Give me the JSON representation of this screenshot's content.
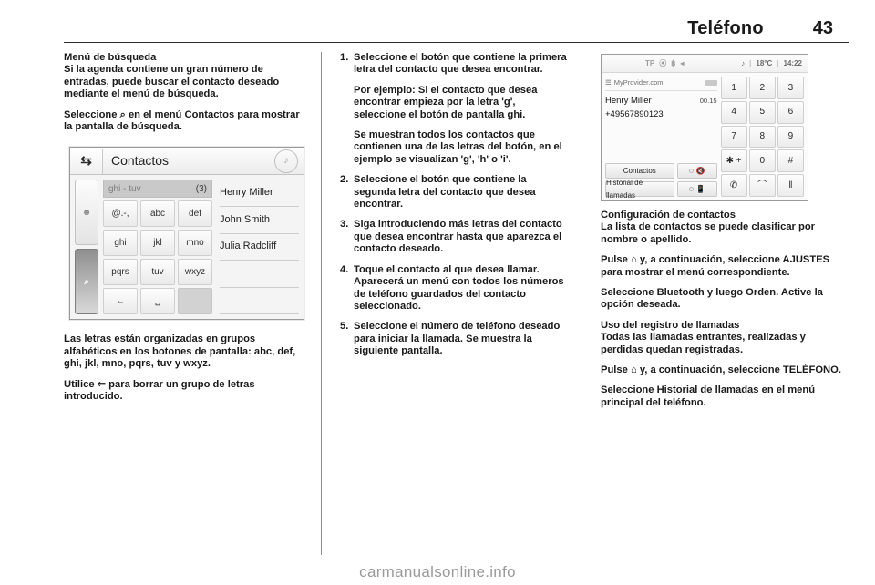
{
  "header": {
    "title": "Teléfono",
    "page_number": "43"
  },
  "footer": {
    "watermark": "carmanualsonline.info"
  },
  "left_column": {
    "heading": "Menú de búsqueda",
    "paragraph_1": "Si la agenda contiene un gran número de entradas, puede buscar el contacto deseado mediante el menú de búsqueda.",
    "paragraph_2_before": "Seleccione",
    "paragraph_2_icon": "⌕",
    "paragraph_2_after": "en el menú Contactos para mostrar la pantalla de búsqueda.",
    "paragraph_3": "Las letras están organizadas en grupos alfabéticos en los botones de pantalla: abc, def, ghi, jkl, mno, pqrs, tuv y wxyz.",
    "paragraph_4_before": "Utilice",
    "paragraph_4_icon": "⇐",
    "paragraph_4_after": "para borrar un grupo de letras introducido."
  },
  "contacts_screen": {
    "back_icon": "⇆",
    "title": "Contactos",
    "note_icon": "♪",
    "side_tabs": [
      {
        "icon": "person-icon",
        "glyph": "♟",
        "active": false
      },
      {
        "icon": "search-icon",
        "glyph": "⚲",
        "active": true
      }
    ],
    "search_field": {
      "value": "ghi - tuv",
      "count": "(3)"
    },
    "keys": [
      "@.-,",
      "abc",
      "def",
      "ghi",
      "jkl",
      "mno",
      "pqrs",
      "tuv",
      "wxyz",
      "←",
      "␣",
      ""
    ],
    "results": [
      "Henry Miller",
      "John Smith",
      "Julia Radcliff",
      "",
      ""
    ]
  },
  "middle_column": {
    "steps": [
      {
        "num": "1.",
        "lines": [
          "Seleccione el botón que contiene la primera letra del contacto que desea encontrar.",
          "Por ejemplo: Si el contacto que desea encontrar empieza por la letra 'g', seleccione el botón de pantalla ghi.",
          "Se muestran todos los contactos que contienen una de las letras del botón, en el ejemplo se visualizan 'g', 'h' o 'i'."
        ]
      },
      {
        "num": "2.",
        "lines": [
          "Seleccione el botón que contiene la segunda letra del contacto que desea encontrar."
        ]
      },
      {
        "num": "3.",
        "lines": [
          "Siga introduciendo más letras del contacto que desea encontrar hasta que aparezca el contacto deseado."
        ]
      },
      {
        "num": "4.",
        "lines": [
          "Toque el contacto al que desea llamar. Aparecerá un menú con todos los números de teléfono guardados del contacto seleccionado."
        ]
      },
      {
        "num": "5.",
        "lines": [
          "Seleccione el número de teléfono deseado para iniciar la llamada. Se muestra la siguiente pantalla."
        ]
      }
    ]
  },
  "phone_screen": {
    "status_icons": [
      "TP",
      "⦿",
      "฿",
      "◂"
    ],
    "media_icon": "♪",
    "temperature": "18°C",
    "time": "14:22",
    "signal_icon": "signal-icon",
    "provider": "MyProvider.com",
    "contact_name": "Henry Miller",
    "call_duration": "00.15",
    "phone_number": "+49567890123",
    "buttons": {
      "contacts": "Contactos",
      "call_history": "Historial de llamadas",
      "mute_icon": "mute-microphone-icon",
      "handset_icon": "handset-transfer-icon"
    },
    "keypad": [
      "1",
      "2",
      "3",
      "4",
      "5",
      "6",
      "7",
      "8",
      "9",
      "✱ +",
      "0",
      "#",
      "✆",
      "⌒",
      "‖"
    ]
  },
  "right_column": {
    "heading_1": "Configuración de contactos",
    "paragraph_1": "La lista de contactos se puede clasificar por nombre o apellido.",
    "paragraph_2_before": "Pulse",
    "paragraph_2_icon": "⌂",
    "paragraph_2_after": "y, a continuación, seleccione AJUSTES para mostrar el menú correspondiente.",
    "paragraph_3": "Seleccione Bluetooth y luego Orden. Active la opción deseada.",
    "heading_2": "Uso del registro de llamadas",
    "paragraph_4": "Todas las llamadas entrantes, realizadas y perdidas quedan registradas.",
    "paragraph_5_before": "Pulse",
    "paragraph_5_icon": "⌂",
    "paragraph_5_after": "y, a continuación, seleccione TELÉFONO.",
    "paragraph_6": "Seleccione Historial de llamadas en el menú principal del teléfono."
  }
}
